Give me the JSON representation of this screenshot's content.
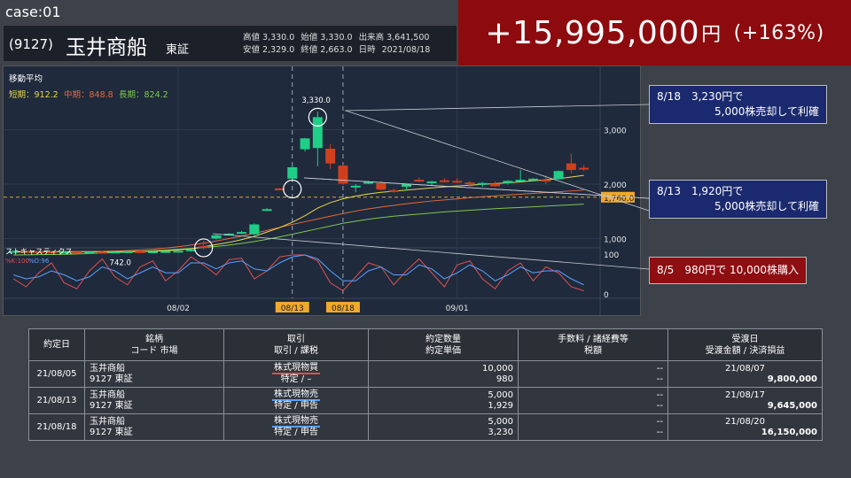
{
  "case_label": "case:01",
  "header": {
    "code": "(9127)",
    "name": "玉井商船",
    "exchange": "東証",
    "high": "高値 3,330.0",
    "open": "始値 3,330.0",
    "volume": "出来高 3,641,500",
    "low": "安値 2,329.0",
    "close": "終値 2,663.0",
    "date_label": "日時",
    "date": "2021/08/18"
  },
  "profit": {
    "amount": "+15,995,000",
    "unit": "円",
    "percent": "(+163%)"
  },
  "chart_data": {
    "type": "candlestick",
    "indicator_title": "移動平均",
    "ma_labels": [
      {
        "text": "短期：912.2",
        "color": "#e8d84a"
      },
      {
        "text": "中期：848.8",
        "color": "#e46a3a"
      },
      {
        "text": "長期：824.2",
        "color": "#7ec850"
      }
    ],
    "stoch_title": "ストキャスティクス",
    "stoch_labels": [
      {
        "text": "%K:100",
        "color": "#e05050"
      },
      {
        "text": "%D:96",
        "color": "#5aa0ff"
      }
    ],
    "ylim": [
      0,
      3500
    ],
    "price_ticks": [
      "3,000",
      "2,000",
      "1,000"
    ],
    "stoch_ticks": [
      "100",
      "0"
    ],
    "reference_line": {
      "value": 1760,
      "label": "1,760.0"
    },
    "annotations": [
      {
        "text": "3,330.0",
        "value": 3330
      },
      {
        "text": "742.0",
        "value": 742
      }
    ],
    "x_ticks": [
      "08/02",
      "08/13",
      "08/18",
      "09/01"
    ],
    "highlight_ticks": [
      "08/13",
      "08/18"
    ],
    "candles": [
      {
        "o": 760,
        "h": 780,
        "l": 740,
        "c": 770
      },
      {
        "o": 770,
        "h": 780,
        "l": 750,
        "c": 765
      },
      {
        "o": 765,
        "h": 775,
        "l": 745,
        "c": 760
      },
      {
        "o": 760,
        "h": 770,
        "l": 742,
        "c": 755
      },
      {
        "o": 755,
        "h": 770,
        "l": 745,
        "c": 760
      },
      {
        "o": 760,
        "h": 775,
        "l": 745,
        "c": 750
      },
      {
        "o": 750,
        "h": 765,
        "l": 742,
        "c": 758
      },
      {
        "o": 758,
        "h": 770,
        "l": 745,
        "c": 752
      },
      {
        "o": 752,
        "h": 762,
        "l": 742,
        "c": 760
      },
      {
        "o": 760,
        "h": 775,
        "l": 748,
        "c": 766
      },
      {
        "o": 766,
        "h": 775,
        "l": 752,
        "c": 760
      },
      {
        "o": 760,
        "h": 772,
        "l": 748,
        "c": 764
      },
      {
        "o": 764,
        "h": 780,
        "l": 752,
        "c": 770
      },
      {
        "o": 770,
        "h": 790,
        "l": 760,
        "c": 775
      },
      {
        "o": 775,
        "h": 810,
        "l": 760,
        "c": 800
      },
      {
        "o": 860,
        "h": 960,
        "l": 800,
        "c": 830
      },
      {
        "o": 1000,
        "h": 1070,
        "l": 980,
        "c": 1060
      },
      {
        "o": 1080,
        "h": 1100,
        "l": 1060,
        "c": 1090
      },
      {
        "o": 1100,
        "h": 1140,
        "l": 1080,
        "c": 1120
      },
      {
        "o": 1080,
        "h": 1280,
        "l": 1060,
        "c": 1260
      },
      {
        "o": 1540,
        "h": 1560,
        "l": 1520,
        "c": 1540
      },
      {
        "o": 1920,
        "h": 1930,
        "l": 1900,
        "c": 1910
      },
      {
        "o": 2100,
        "h": 2330,
        "l": 2090,
        "c": 2310
      },
      {
        "o": 2640,
        "h": 2850,
        "l": 2600,
        "c": 2840
      },
      {
        "o": 2663,
        "h": 3330,
        "l": 2329,
        "c": 3230
      },
      {
        "o": 2650,
        "h": 2740,
        "l": 2280,
        "c": 2380
      },
      {
        "o": 2340,
        "h": 2360,
        "l": 1990,
        "c": 2010
      },
      {
        "o": 1960,
        "h": 2000,
        "l": 1850,
        "c": 1970
      },
      {
        "o": 2020,
        "h": 2060,
        "l": 2000,
        "c": 2040
      },
      {
        "o": 2020,
        "h": 2050,
        "l": 1880,
        "c": 1900
      },
      {
        "o": 1890,
        "h": 1920,
        "l": 1840,
        "c": 1880
      },
      {
        "o": 1950,
        "h": 2000,
        "l": 1880,
        "c": 2000
      },
      {
        "o": 2080,
        "h": 2120,
        "l": 2040,
        "c": 2060
      },
      {
        "o": 2030,
        "h": 2060,
        "l": 1980,
        "c": 2050
      },
      {
        "o": 2070,
        "h": 2110,
        "l": 2030,
        "c": 2060
      },
      {
        "o": 2060,
        "h": 2110,
        "l": 2020,
        "c": 2040
      },
      {
        "o": 2030,
        "h": 2060,
        "l": 1950,
        "c": 2000
      },
      {
        "o": 2000,
        "h": 2040,
        "l": 1950,
        "c": 2020
      },
      {
        "o": 2010,
        "h": 2050,
        "l": 1950,
        "c": 1960
      },
      {
        "o": 2020,
        "h": 2070,
        "l": 1990,
        "c": 2060
      },
      {
        "o": 2060,
        "h": 2260,
        "l": 2040,
        "c": 2080
      },
      {
        "o": 2080,
        "h": 2110,
        "l": 2060,
        "c": 2100
      },
      {
        "o": 2080,
        "h": 2160,
        "l": 2000,
        "c": 2070
      },
      {
        "o": 2090,
        "h": 2250,
        "l": 2080,
        "c": 2240
      },
      {
        "o": 2380,
        "h": 2560,
        "l": 2200,
        "c": 2260
      },
      {
        "o": 2300,
        "h": 2350,
        "l": 2240,
        "c": 2270
      }
    ],
    "ma_long": [
      700,
      702,
      705,
      708,
      712,
      718,
      725,
      733,
      742,
      752,
      763,
      775,
      788,
      802,
      818,
      835,
      855,
      880,
      910,
      945,
      985,
      1030,
      1080,
      1130,
      1180,
      1230,
      1280,
      1320,
      1355,
      1385,
      1410,
      1430,
      1450,
      1470,
      1490,
      1505,
      1520,
      1535,
      1548,
      1560,
      1572,
      1584,
      1596,
      1608,
      1620,
      1632
    ],
    "ma_mid": [
      750,
      752,
      754,
      756,
      758,
      760,
      762,
      765,
      770,
      778,
      790,
      805,
      825,
      850,
      880,
      915,
      955,
      1000,
      1045,
      1095,
      1150,
      1205,
      1260,
      1310,
      1360,
      1410,
      1460,
      1505,
      1545,
      1580,
      1610,
      1640,
      1665,
      1690,
      1710,
      1730,
      1750,
      1768,
      1785,
      1800,
      1815,
      1830,
      1845,
      1860,
      1875,
      1890
    ],
    "ma_short": [
      760,
      761,
      760,
      759,
      760,
      759,
      758,
      759,
      760,
      762,
      764,
      768,
      775,
      790,
      810,
      850,
      890,
      930,
      980,
      1040,
      1120,
      1200,
      1300,
      1420,
      1560,
      1660,
      1730,
      1780,
      1820,
      1850,
      1870,
      1890,
      1910,
      1930,
      1950,
      1965,
      1980,
      1995,
      2010,
      2025,
      2040,
      2060,
      2080,
      2100,
      2130,
      2160
    ],
    "stoch_k": [
      40,
      20,
      55,
      80,
      30,
      15,
      60,
      90,
      45,
      25,
      70,
      85,
      35,
      60,
      95,
      75,
      50,
      88,
      92,
      40,
      60,
      95,
      100,
      100,
      85,
      30,
      10,
      45,
      80,
      70,
      25,
      60,
      90,
      55,
      20,
      75,
      85,
      40,
      15,
      60,
      80,
      35,
      70,
      55,
      20,
      10
    ],
    "stoch_d": [
      50,
      40,
      45,
      60,
      50,
      35,
      45,
      70,
      60,
      40,
      55,
      70,
      55,
      55,
      80,
      80,
      65,
      80,
      85,
      65,
      60,
      80,
      95,
      100,
      90,
      60,
      35,
      35,
      60,
      70,
      50,
      50,
      75,
      65,
      40,
      55,
      75,
      60,
      35,
      50,
      70,
      55,
      60,
      60,
      40,
      25
    ]
  },
  "callouts": [
    {
      "line1": "8/18　3,230円で",
      "line2": "5,000株売却して利確"
    },
    {
      "line1": "8/13　1,920円で",
      "line2": "5,000株売却して利確"
    },
    {
      "line1": "8/5　980円で 10,000株購入"
    }
  ],
  "table": {
    "headers": [
      [
        "約定日"
      ],
      [
        "銘柄",
        "コード 市場"
      ],
      [
        "取引",
        "取引 / 課税"
      ],
      [
        "約定数量",
        "約定単価"
      ],
      [
        "手数料 / 諸経費等",
        "税額"
      ],
      [
        "受渡日",
        "受渡金額 / 決済損益"
      ]
    ],
    "rows": [
      {
        "date": "21/08/05",
        "name": "玉井商船",
        "code": "9127 東証",
        "trade": "株式現物買",
        "tax": "特定 / –",
        "qty": "10,000",
        "price": "980",
        "fee": "--",
        "taxamt": "--",
        "settle": "21/08/07",
        "amount": "9,800,000"
      },
      {
        "date": "21/08/13",
        "name": "玉井商船",
        "code": "9127 東証",
        "trade": "株式現物売",
        "tax": "特定 / 申告",
        "qty": "5,000",
        "price": "1,929",
        "fee": "--",
        "taxamt": "--",
        "settle": "21/08/17",
        "amount": "9,645,000"
      },
      {
        "date": "21/08/18",
        "name": "玉井商船",
        "code": "9127 東証",
        "trade": "株式現物売",
        "tax": "特定 / 申告",
        "qty": "5,000",
        "price": "3,230",
        "fee": "--",
        "taxamt": "--",
        "settle": "21/08/20",
        "amount": "16,150,000"
      }
    ]
  }
}
